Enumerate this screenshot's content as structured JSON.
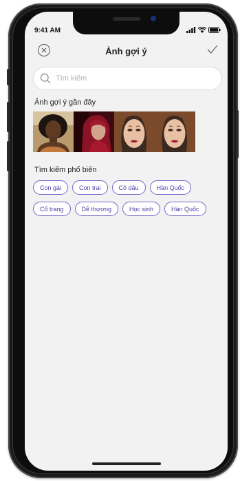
{
  "status_bar": {
    "time": "9:41 AM"
  },
  "header": {
    "title": "Ảnh gợi ý"
  },
  "search": {
    "placeholder": "Tìm kiếm"
  },
  "recent": {
    "title": "Ảnh gợi ý gần đây",
    "photos": [
      {
        "icon": "portrait-woman-curly-hair"
      },
      {
        "icon": "portrait-woman-red-headscarf"
      },
      {
        "icon": "portrait-woman-red-lips"
      },
      {
        "icon": "portrait-woman-red-lips"
      }
    ]
  },
  "popular": {
    "title": "Tìm kiếm phổ biến",
    "row1": [
      "Con gái",
      "Con trai",
      "Cô dâu",
      "Hàn Quốc"
    ],
    "row2": [
      "Cổ trang",
      "Dễ thương",
      "Học sinh",
      "Hàn Quốc"
    ]
  },
  "colors": {
    "chip_border": "#7367c9",
    "chip_text": "#4a3fa6",
    "screen_bg": "#f2f2f2",
    "frame": "#1b1b1b"
  }
}
